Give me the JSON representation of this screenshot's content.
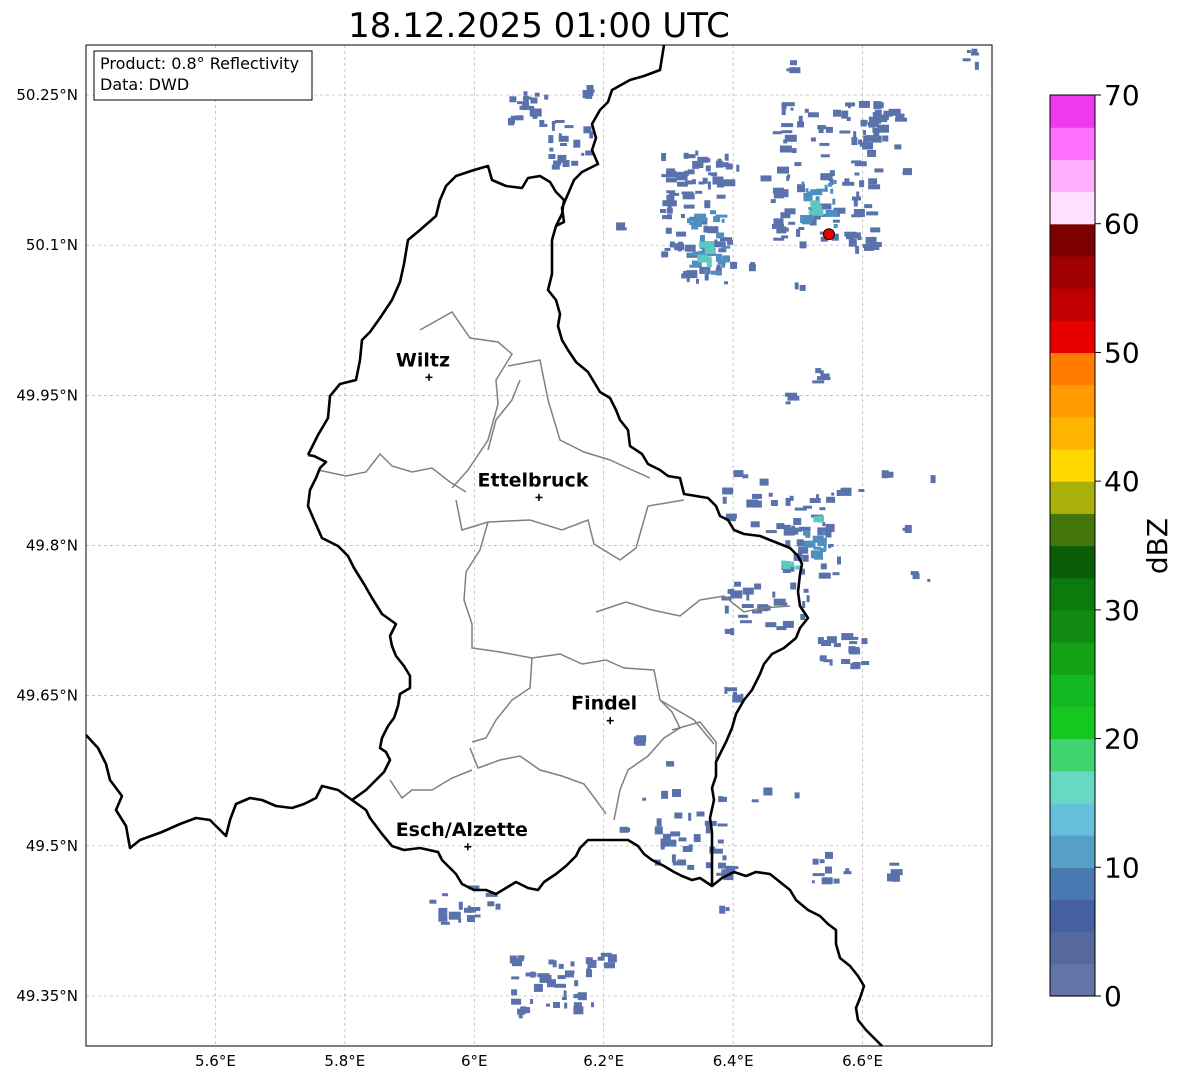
{
  "title": "18.12.2025 01:00 UTC",
  "info_box": {
    "product_line": "Product: 0.8° Reflectivity",
    "data_line": "Data: DWD"
  },
  "map": {
    "lon_range": [
      5.4,
      6.8
    ],
    "lat_range": [
      49.3,
      50.3
    ],
    "lon_ticks": [
      5.6,
      5.8,
      6.0,
      6.2,
      6.4,
      6.6
    ],
    "lat_ticks": [
      49.35,
      49.5,
      49.65,
      49.8,
      49.95,
      50.1,
      50.25
    ],
    "lon_tick_labels": [
      "5.6°E",
      "5.8°E",
      "6°E",
      "6.2°E",
      "6.4°E",
      "6.6°E"
    ],
    "lat_tick_labels": [
      "49.35°N",
      "49.5°N",
      "49.65°N",
      "49.8°N",
      "49.95°N",
      "50.1°N",
      "50.25°N"
    ],
    "gridlines": true
  },
  "cities": [
    {
      "name": "Wiltz",
      "lon": 5.93,
      "lat": 49.968
    },
    {
      "name": "Ettelbruck",
      "lon": 6.1,
      "lat": 49.848
    },
    {
      "name": "Findel",
      "lon": 6.21,
      "lat": 49.625
    },
    {
      "name": "Esch/Alzette",
      "lon": 5.99,
      "lat": 49.499
    }
  ],
  "radar_site": {
    "lon": 6.548,
    "lat": 50.111,
    "color": "#ee0000"
  },
  "colorbar": {
    "label": "dBZ",
    "min": 0,
    "max": 70,
    "step": 2.5,
    "tick_values": [
      0,
      10,
      20,
      30,
      40,
      50,
      60,
      70
    ],
    "tick_labels": [
      "0",
      "10",
      "20",
      "30",
      "40",
      "50",
      "60",
      "70"
    ],
    "colors": [
      "#6574a6",
      "#56699c",
      "#4460a0",
      "#4a78b0",
      "#56a0c6",
      "#66c0dc",
      "#66d8c4",
      "#40d470",
      "#14c820",
      "#14b820",
      "#12a214",
      "#108a10",
      "#0c7a0c",
      "#0a5e0a",
      "#44760c",
      "#aab00a",
      "#ffd800",
      "#ffb400",
      "#ff9a00",
      "#ff7c00",
      "#e80000",
      "#c00000",
      "#a00000",
      "#7c0000",
      "#ffe0ff",
      "#ffb0ff",
      "#ff70ff",
      "#ee3aee"
    ]
  },
  "echo_colors": {
    "weak": "#5a72ab",
    "moderate": "#4f8fc0",
    "strong": "#5cc8c0",
    "core": "#40c060"
  }
}
